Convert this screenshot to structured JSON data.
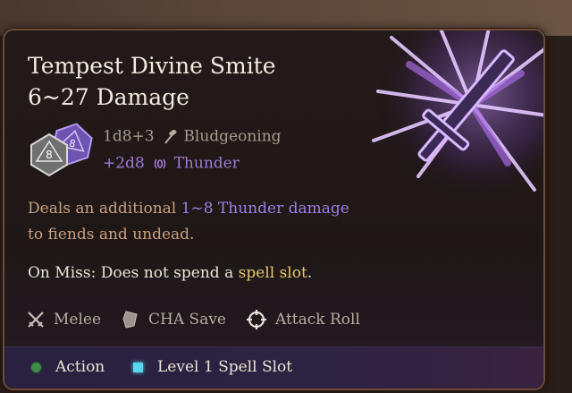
{
  "spell": {
    "name": "Tempest Divine Smite",
    "damage_range": "6~27 Damage"
  },
  "damage": {
    "primary_formula": "1d8+3",
    "primary_type": "Bludgeoning",
    "primary_icon": "hammer-icon",
    "secondary_formula": "+2d8",
    "secondary_type": "Thunder",
    "secondary_icon": "thunder-icon",
    "die_label_front": "8",
    "die_label_back": "8"
  },
  "description": {
    "before": "Deals an additional ",
    "highlight": "1~8 Thunder damage",
    "after": "to fiends and undead."
  },
  "on_miss": {
    "before": "On Miss: Does not spend a ",
    "highlight": "spell slot",
    "after": "."
  },
  "properties": [
    {
      "label": "Melee",
      "icon": "crossed-swords-icon"
    },
    {
      "label": "CHA Save",
      "icon": "shield-icon"
    },
    {
      "label": "Attack Roll",
      "icon": "crosshair-icon"
    }
  ],
  "costs": [
    {
      "label": "Action",
      "icon": "green-dot-icon",
      "color": "#3f8a48"
    },
    {
      "label": "Level 1 Spell Slot",
      "icon": "blue-square-icon",
      "color": "#58d6f0"
    }
  ],
  "colors": {
    "accent_purple": "#9f7ee6",
    "highlight_gold": "#e8c86a",
    "description_tan": "#c9a07e",
    "border_bronze": "#6b4a36"
  }
}
